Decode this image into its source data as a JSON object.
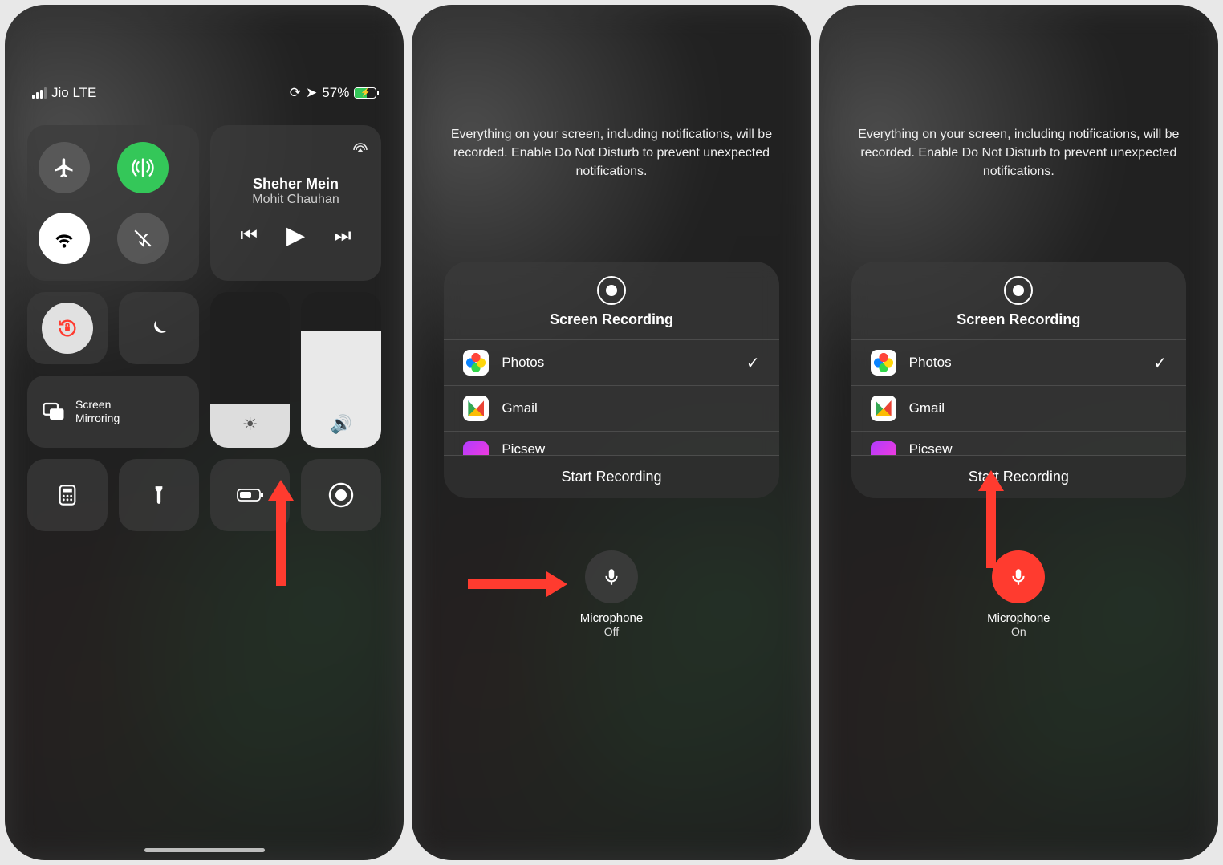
{
  "status": {
    "carrier": "Jio LTE",
    "battery_text": "57%"
  },
  "media": {
    "title": "Sheher Mein",
    "artist": "Mohit Chauhan"
  },
  "mirror_label": "Screen\nMirroring",
  "panel": {
    "notice": "Everything on your screen, including notifications, will be recorded. Enable Do Not Disturb to prevent unexpected notifications.",
    "title": "Screen Recording",
    "apps": [
      {
        "name": "Photos",
        "selected": true,
        "cls": "photos"
      },
      {
        "name": "Gmail",
        "selected": false,
        "cls": "gmail"
      }
    ],
    "cut_app": "Picsew",
    "start": "Start Recording"
  },
  "mic": {
    "label": "Microphone",
    "off": "Off",
    "on": "On"
  }
}
